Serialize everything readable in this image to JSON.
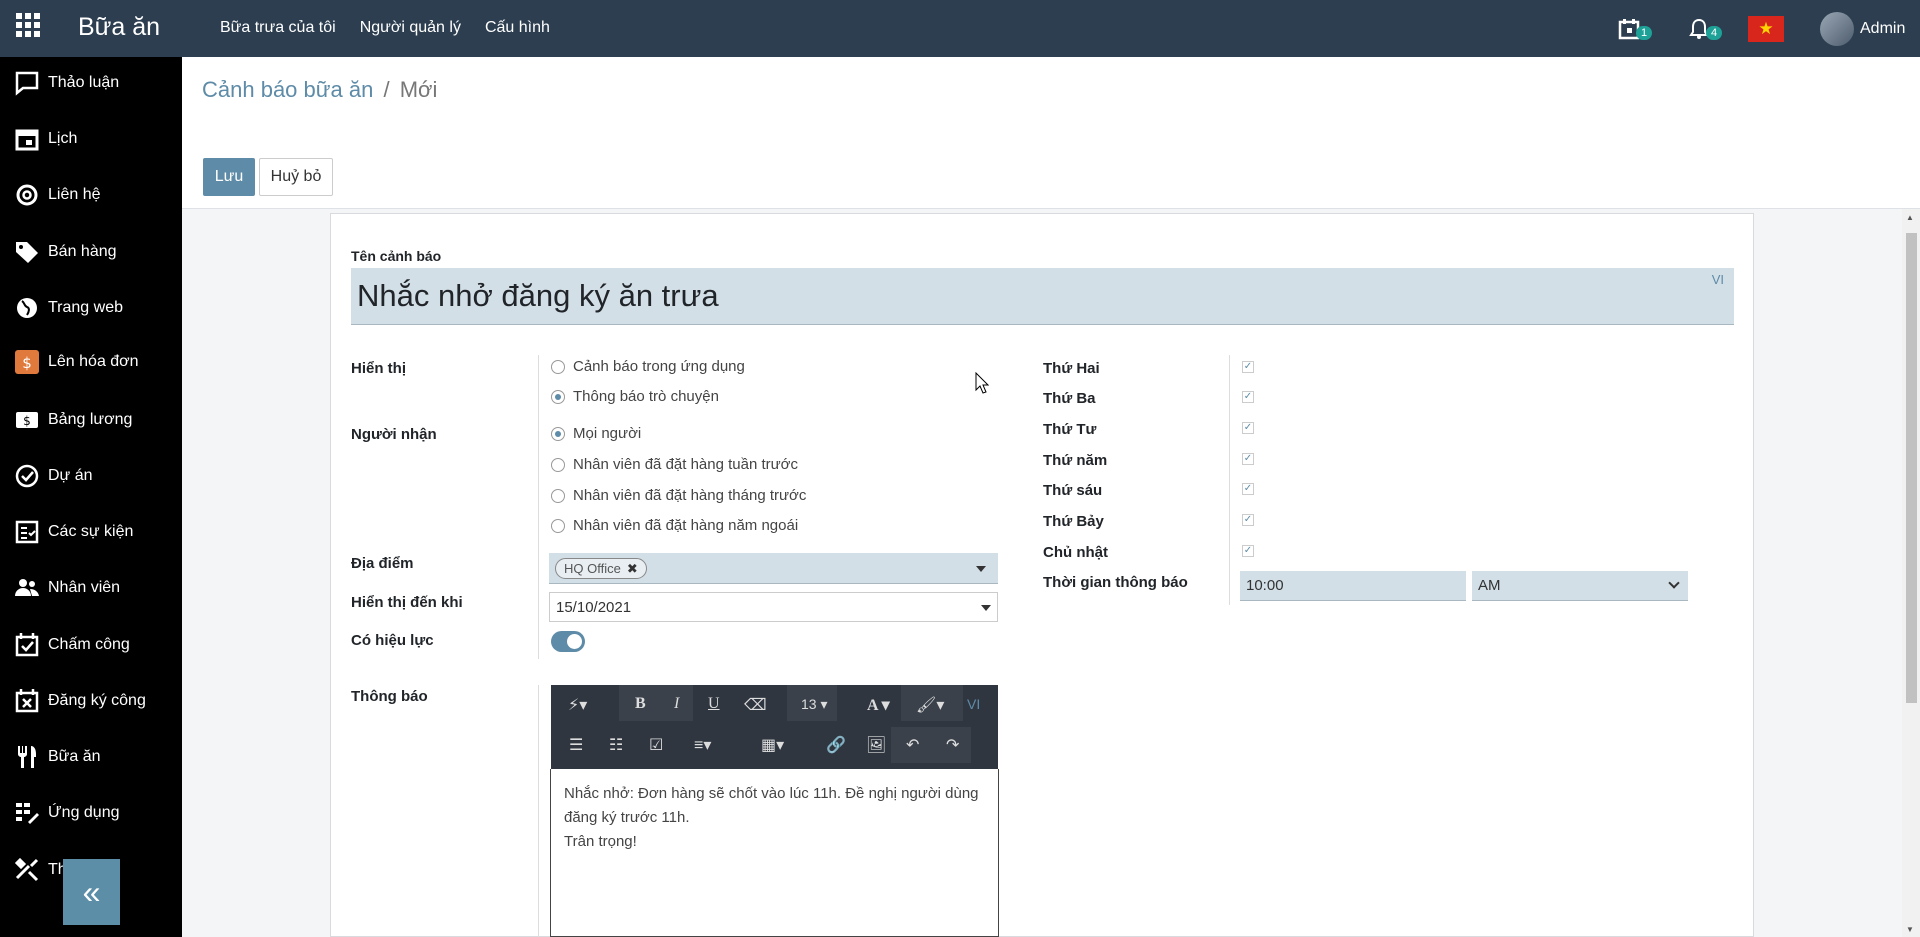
{
  "navbar": {
    "app_title": "Bữa ăn",
    "menu": [
      "Bữa trưa của tôi",
      "Người quản lý",
      "Cấu hình"
    ],
    "activity_count": "1",
    "notification_count": "4",
    "flag_icon": "vietnam-flag-icon",
    "user_name": "Admin"
  },
  "sidebar": {
    "items": [
      {
        "label": "Thảo luận",
        "icon": "chat-icon"
      },
      {
        "label": "Lịch",
        "icon": "calendar-icon"
      },
      {
        "label": "Liên hệ",
        "icon": "at-icon"
      },
      {
        "label": "Bán hàng",
        "icon": "tag-icon"
      },
      {
        "label": "Trang web",
        "icon": "globe-icon"
      },
      {
        "label": "Lên hóa đơn",
        "icon": "invoice-icon"
      },
      {
        "label": "Bảng lương",
        "icon": "payroll-icon"
      },
      {
        "label": "Dự án",
        "icon": "check-circle-icon"
      },
      {
        "label": "Các sự kiện",
        "icon": "event-icon"
      },
      {
        "label": "Nhân viên",
        "icon": "users-icon"
      },
      {
        "label": "Chấm công",
        "icon": "attendance-icon"
      },
      {
        "label": "Đăng ký công",
        "icon": "timeoff-icon"
      },
      {
        "label": "Bữa ăn",
        "icon": "cutlery-icon"
      },
      {
        "label": "Ứng dụng",
        "icon": "apps-icon"
      },
      {
        "label": "Th",
        "icon": "tools-icon"
      }
    ],
    "collapse_label": "«"
  },
  "breadcrumb": {
    "parent": "Cảnh báo bữa ăn",
    "separator": "/",
    "current": "Mới"
  },
  "buttons": {
    "save": "Lưu",
    "discard": "Huỷ bỏ"
  },
  "form": {
    "name_label": "Tên cảnh báo",
    "name_value": "Nhắc nhở đăng ký ăn trưa",
    "lang": "VI",
    "display_label": "Hiển thị",
    "display_options": [
      {
        "label": "Cảnh báo trong ứng dụng",
        "selected": false
      },
      {
        "label": "Thông báo trò chuyện",
        "selected": true
      }
    ],
    "recipients_label": "Người nhận",
    "recipient_options": [
      {
        "label": "Mọi người",
        "selected": true
      },
      {
        "label": "Nhân viên đã đặt hàng tuần trước",
        "selected": false
      },
      {
        "label": "Nhân viên đã đặt hàng tháng trước",
        "selected": false
      },
      {
        "label": "Nhân viên đã đặt hàng năm ngoái",
        "selected": false
      }
    ],
    "location_label": "Địa điểm",
    "location_tag": "HQ Office",
    "until_label": "Hiển thị đến khi",
    "until_value": "15/10/2021",
    "active_label": "Có hiệu lực",
    "active": true,
    "message_label": "Thông báo",
    "editor": {
      "font_size": "13",
      "lang": "VI",
      "lines": [
        "Nhắc nhở: Đơn hàng sẽ chốt vào lúc 11h. Đề nghị người dùng đăng ký trước 11h.",
        "Trân trọng!"
      ]
    },
    "days": [
      {
        "label": "Thứ Hai",
        "checked": true
      },
      {
        "label": "Thứ Ba",
        "checked": true
      },
      {
        "label": "Thứ Tư",
        "checked": true
      },
      {
        "label": "Thứ năm",
        "checked": true
      },
      {
        "label": "Thứ sáu",
        "checked": true
      },
      {
        "label": "Thứ Bảy",
        "checked": true
      },
      {
        "label": "Chủ nhật",
        "checked": true
      }
    ],
    "notify_time_label": "Thời gian thông báo",
    "notify_time": "10:00",
    "notify_ampm": "AM"
  }
}
